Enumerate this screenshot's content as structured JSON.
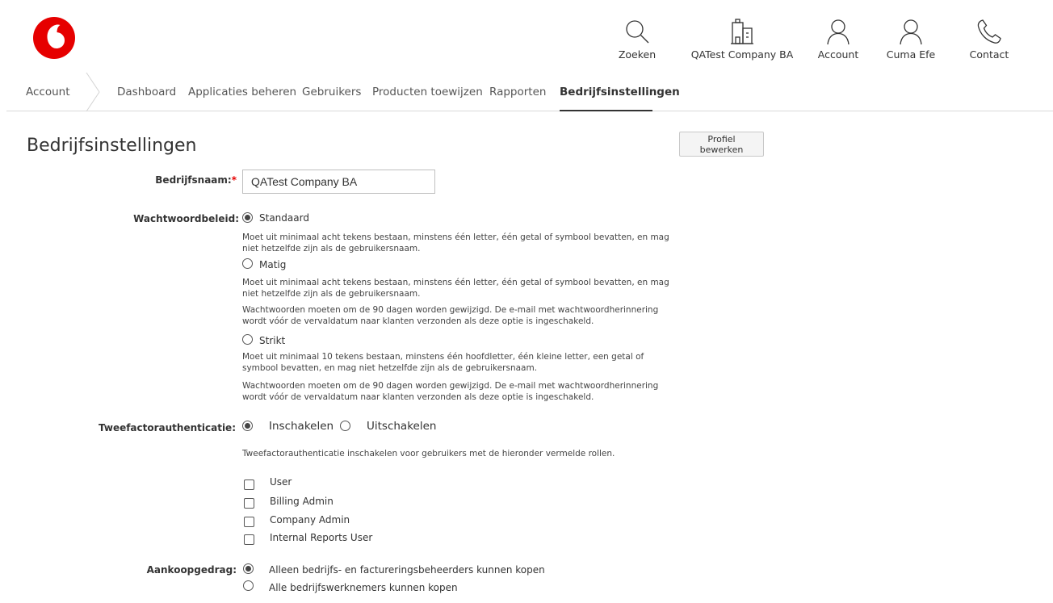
{
  "header": {
    "icons": [
      {
        "key": "search",
        "label": "Zoeken"
      },
      {
        "key": "company",
        "label": "QATest Company BA"
      },
      {
        "key": "account",
        "label": "Account"
      },
      {
        "key": "user",
        "label": "Cuma Efe"
      },
      {
        "key": "contact",
        "label": "Contact"
      }
    ]
  },
  "nav": {
    "root": "Account",
    "items": [
      {
        "label": "Dashboard"
      },
      {
        "label": "Applicaties beheren"
      },
      {
        "label": "Gebruikers"
      },
      {
        "label": "Producten toewijzen"
      },
      {
        "label": "Rapporten"
      },
      {
        "label": "Bedrijfsinstellingen"
      }
    ],
    "active_index": 5
  },
  "page": {
    "title": "Bedrijfsinstellingen",
    "edit_button": "Profiel bewerken"
  },
  "form": {
    "company_name": {
      "label": "Bedrijfsnaam:",
      "required_mark": "*",
      "value": "QATest Company BA"
    },
    "password_policy": {
      "label": "Wachtwoordbeleid:",
      "options": [
        {
          "label": "Standaard",
          "checked": true,
          "descriptions": [
            "Moet uit minimaal acht tekens bestaan, minstens één letter, één getal of symbool bevatten, en mag niet hetzelfde zijn als de gebruikersnaam."
          ]
        },
        {
          "label": "Matig",
          "checked": false,
          "descriptions": [
            "Moet uit minimaal acht tekens bestaan, minstens één letter, één getal of symbool bevatten, en mag niet hetzelfde zijn als de gebruikersnaam.",
            "Wachtwoorden moeten om de 90 dagen worden gewijzigd. De e-mail met wachtwoordherinnering wordt vóór de vervaldatum naar klanten verzonden als deze optie is ingeschakeld."
          ]
        },
        {
          "label": "Strikt",
          "checked": false,
          "descriptions": [
            "Moet uit minimaal 10 tekens bestaan, minstens één hoofdletter, één kleine letter, een getal of symbool bevatten, en mag niet hetzelfde zijn als de gebruikersnaam.",
            "Wachtwoorden moeten om de 90 dagen worden gewijzigd. De e-mail met wachtwoordherinnering wordt vóór de vervaldatum naar klanten verzonden als deze optie is ingeschakeld."
          ]
        }
      ]
    },
    "two_factor": {
      "label": "Tweefactorauthenticatie:",
      "options": [
        {
          "label": "Inschakelen",
          "checked": true
        },
        {
          "label": "Uitschakelen",
          "checked": false
        }
      ],
      "hint": "Tweefactorauthenticatie inschakelen voor gebruikers met de hieronder vermelde rollen.",
      "roles": [
        {
          "label": "User",
          "checked": false
        },
        {
          "label": "Billing Admin",
          "checked": false
        },
        {
          "label": "Company Admin",
          "checked": false
        },
        {
          "label": "Internal Reports User",
          "checked": false
        }
      ]
    },
    "purchase": {
      "label": "Aankoopgedrag:",
      "options": [
        {
          "label": "Alleen bedrijfs- en factureringsbeheerders kunnen kopen",
          "checked": true
        },
        {
          "label": "Alle bedrijfswerknemers kunnen kopen",
          "checked": false
        }
      ]
    }
  },
  "colors": {
    "brand_red": "#e60000",
    "text": "#333333"
  }
}
